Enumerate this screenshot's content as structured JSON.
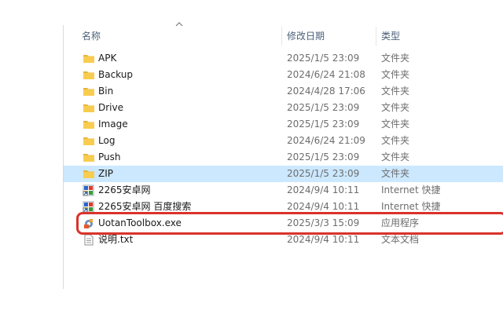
{
  "columns": {
    "name": "名称",
    "date": "修改日期",
    "type": "类型"
  },
  "files": [
    {
      "name": "APK",
      "date": "2025/1/5 23:09",
      "type": "文件夹",
      "icon": "folder-icon"
    },
    {
      "name": "Backup",
      "date": "2024/6/24 21:08",
      "type": "文件夹",
      "icon": "folder-icon"
    },
    {
      "name": "Bin",
      "date": "2024/4/28 17:06",
      "type": "文件夹",
      "icon": "folder-icon"
    },
    {
      "name": "Drive",
      "date": "2025/1/5 23:09",
      "type": "文件夹",
      "icon": "folder-icon"
    },
    {
      "name": "Image",
      "date": "2025/1/5 23:09",
      "type": "文件夹",
      "icon": "folder-icon"
    },
    {
      "name": "Log",
      "date": "2024/6/24 21:09",
      "type": "文件夹",
      "icon": "folder-icon"
    },
    {
      "name": "Push",
      "date": "2025/1/5 23:09",
      "type": "文件夹",
      "icon": "folder-icon"
    },
    {
      "name": "ZIP",
      "date": "2025/1/5 23:09",
      "type": "文件夹",
      "icon": "folder-icon",
      "selected": true
    },
    {
      "name": "2265安卓网",
      "date": "2024/9/4 10:11",
      "type": "Internet 快捷方式",
      "icon": "internet-shortcut-icon"
    },
    {
      "name": "2265安卓网 百度搜索",
      "date": "2024/9/4 10:11",
      "type": "Internet 快捷方式",
      "icon": "internet-shortcut-icon"
    },
    {
      "name": "UotanToolbox.exe",
      "date": "2025/3/3 15:09",
      "type": "应用程序",
      "icon": "application-icon"
    },
    {
      "name": "说明.txt",
      "date": "2024/9/4 10:11",
      "type": "文本文档",
      "icon": "text-document-icon"
    }
  ],
  "colors": {
    "selection": "#cce8ff",
    "highlight": "#d9332b",
    "folder": "#f8cd4f"
  }
}
